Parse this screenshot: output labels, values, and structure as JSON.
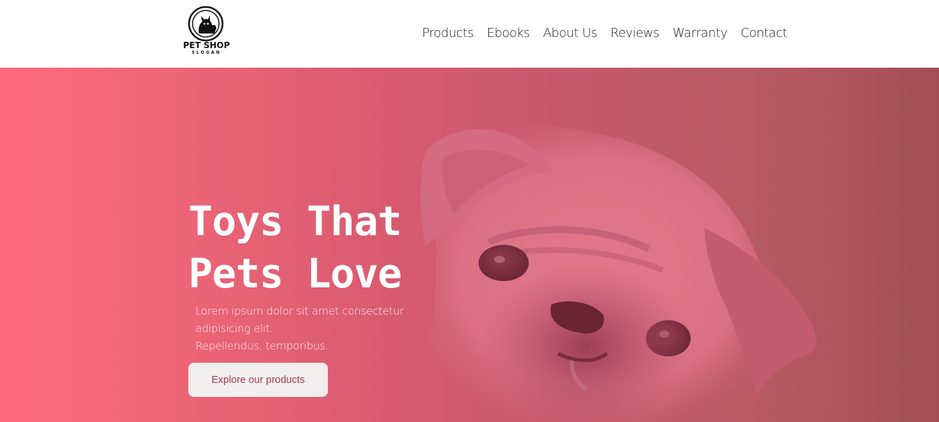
{
  "brand": {
    "name": "PET SHOP",
    "slogan": "SLOGAN",
    "icon": "pet-logo-icon"
  },
  "nav": {
    "items": [
      {
        "label": "Products"
      },
      {
        "label": "Ebooks"
      },
      {
        "label": "About Us"
      },
      {
        "label": "Reviews"
      },
      {
        "label": "Warranty"
      },
      {
        "label": "Contact"
      }
    ]
  },
  "hero": {
    "title_line1": "Toys That",
    "title_line2": "Pets Love",
    "desc_line1": "Lorem ipsum dolor sit amet consectetur",
    "desc_line2": "adipisicing elit.",
    "desc_line3": "Repellendus, temporibus.",
    "cta_label": "Explore our products",
    "image": "pug-photo"
  },
  "colors": {
    "accent": "#fd6b7d",
    "cta_text": "#a33a52",
    "cta_bg": "#f1eeee"
  }
}
